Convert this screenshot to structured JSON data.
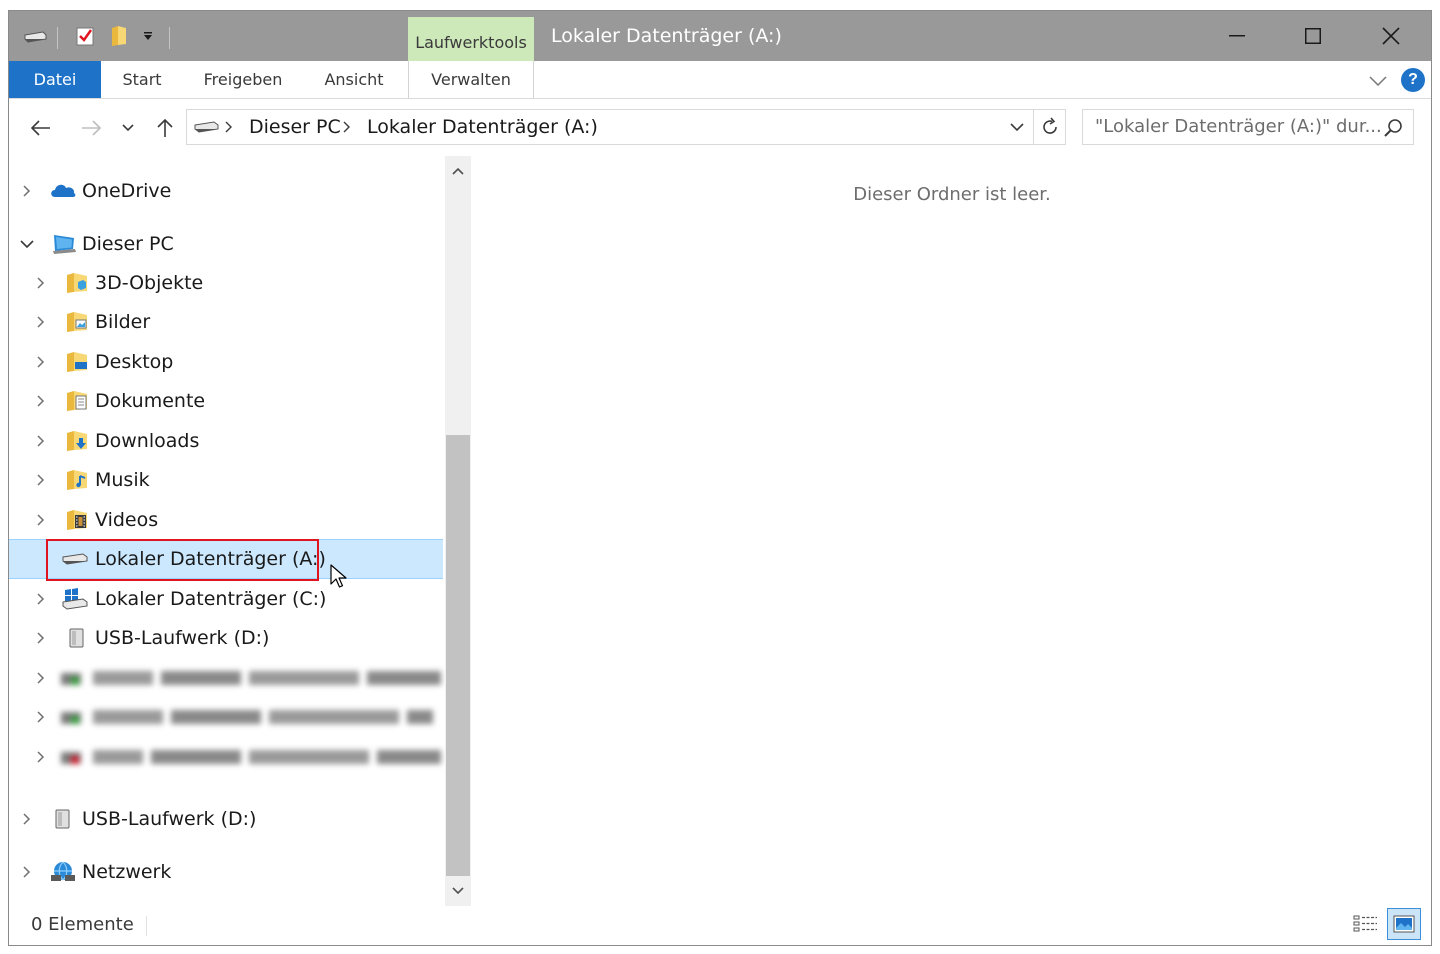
{
  "window": {
    "title": "Lokaler Datenträger (A:)",
    "context_tab_header": "Laufwerktools"
  },
  "ribbon": {
    "tabs": [
      {
        "label": "Datei"
      },
      {
        "label": "Start"
      },
      {
        "label": "Freigeben"
      },
      {
        "label": "Ansicht"
      },
      {
        "label": "Verwalten"
      }
    ],
    "help_label": "?"
  },
  "address_bar": {
    "breadcrumb": [
      "Dieser PC",
      "Lokaler Datenträger (A:)"
    ]
  },
  "search": {
    "placeholder": "\"Lokaler Datenträger (A:)\" dur..."
  },
  "nav_tree": {
    "items": [
      {
        "label": "OneDrive",
        "icon": "onedrive-cloud-icon",
        "expanded": false
      },
      {
        "label": "Dieser PC",
        "icon": "computer-icon",
        "expanded": true
      },
      {
        "label": "3D-Objekte",
        "icon": "3d-objects-folder-icon"
      },
      {
        "label": "Bilder",
        "icon": "pictures-folder-icon"
      },
      {
        "label": "Desktop",
        "icon": "desktop-folder-icon"
      },
      {
        "label": "Dokumente",
        "icon": "documents-folder-icon"
      },
      {
        "label": "Downloads",
        "icon": "downloads-folder-icon"
      },
      {
        "label": "Musik",
        "icon": "music-folder-icon"
      },
      {
        "label": "Videos",
        "icon": "videos-folder-icon"
      },
      {
        "label": "Lokaler Datenträger (A:)",
        "icon": "drive-icon",
        "selected": true
      },
      {
        "label": "Lokaler Datenträger (C:)",
        "icon": "windows-drive-icon"
      },
      {
        "label": "USB-Laufwerk (D:)",
        "icon": "usb-drive-icon"
      },
      {
        "label": "USB-Laufwerk (D:)",
        "icon": "usb-drive-icon"
      },
      {
        "label": "Netzwerk",
        "icon": "network-icon"
      }
    ]
  },
  "content": {
    "empty_message": "Dieser Ordner ist leer."
  },
  "status_bar": {
    "item_count": "0 Elemente"
  },
  "colors": {
    "titlebar": "#999999",
    "accent": "#1e73c8",
    "selection": "#cce8ff",
    "highlight_box": "#e0141e",
    "context_tab": "#cde8b9"
  }
}
